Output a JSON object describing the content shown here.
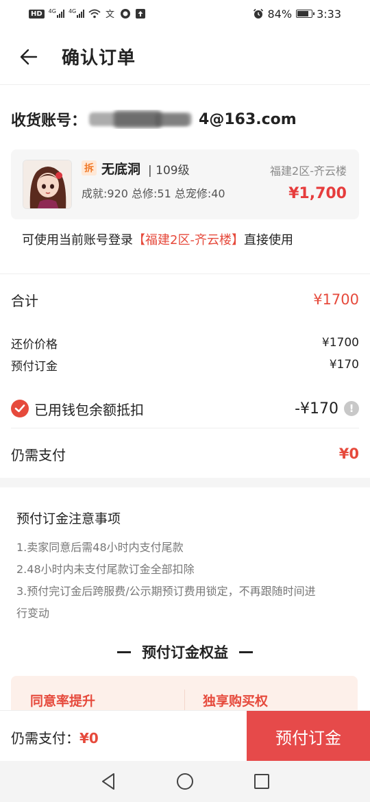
{
  "status_bar": {
    "left_chip": "HD",
    "signal_label_1": "4G",
    "signal_label_2": "4G",
    "battery": "84%",
    "battery_level": 0.84,
    "time": "3:33"
  },
  "nav": {
    "title": "确认订单"
  },
  "account": {
    "label": "收货账号：",
    "value_suffix": "4@163.com"
  },
  "product": {
    "tag": "拆",
    "name": "无底洞",
    "level": "| 109级",
    "stats": "成就:920 总修:51 总宠修:40",
    "server": "福建2区-齐云楼",
    "price": "¥1,700"
  },
  "login_note": {
    "prefix": "可使用当前账号登录",
    "highlight": "【福建2区-齐云楼】",
    "suffix": "直接使用"
  },
  "summary": {
    "total_label": "合计",
    "total_value": "¥1700",
    "counter_label": "还价价格",
    "counter_value": "¥1700",
    "deposit_label": "预付订金",
    "deposit_value": "¥170",
    "wallet_label": "已用钱包余额抵扣",
    "wallet_value": "-¥170",
    "need_label": "仍需支付",
    "need_value": "¥0"
  },
  "notes": {
    "title": "预付订金注意事项",
    "items": [
      "1.卖家同意后需48小时内支付尾款",
      "2.48小时内未支付尾款订金全部扣除",
      "3.预付完订金后跨服费/公示期预订费用锁定，不再跟随时间进",
      "行变动"
    ]
  },
  "benefits": {
    "title": "预付订金权益",
    "left": "同意率提升",
    "right": "独享购买权"
  },
  "pay_bar": {
    "label": "仍需支付：",
    "amount": "¥0",
    "button": "预付订金"
  },
  "colors": {
    "accent": "#e64a3c",
    "pay_button": "#e64a4a"
  }
}
